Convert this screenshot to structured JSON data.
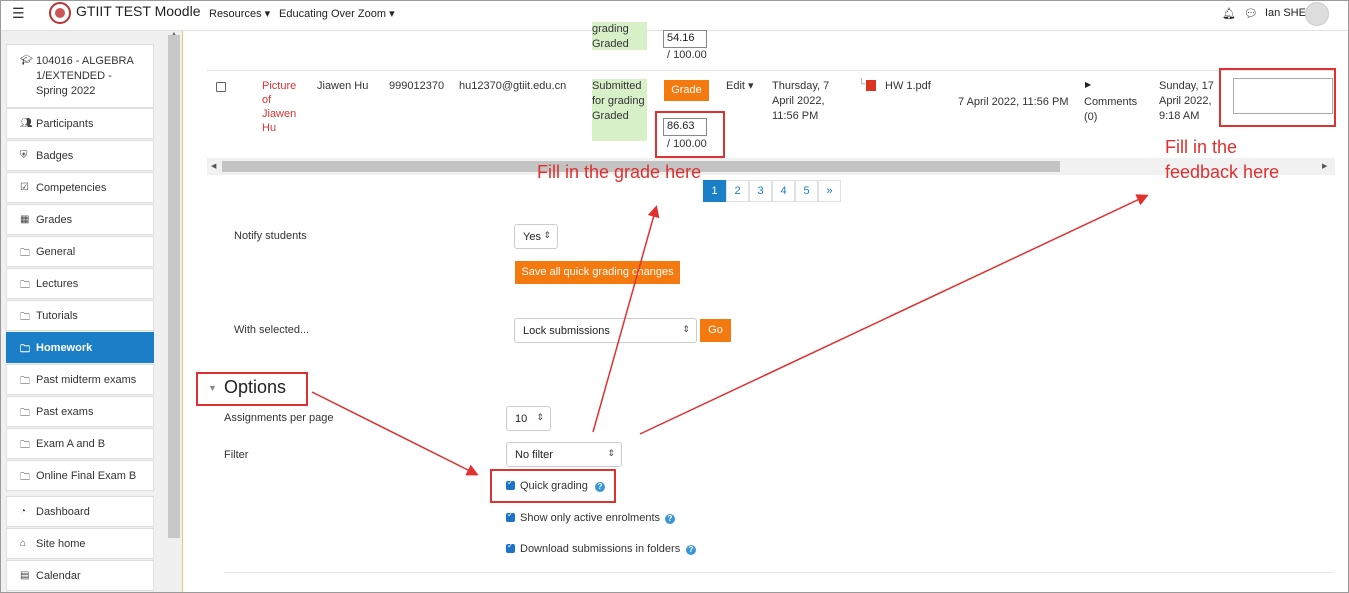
{
  "navbar": {
    "site_name": "GTIIT TEST Moodle",
    "menu_resources": "Resources",
    "menu_zoom": "Educating Over Zoom",
    "user_name": "Ian SHE"
  },
  "sidebar": {
    "course": "104016 - ALGEBRA 1/EXTENDED - Spring 2022",
    "items": [
      {
        "label": "Participants",
        "icon": "users-icon"
      },
      {
        "label": "Badges",
        "icon": "shield-icon"
      },
      {
        "label": "Competencies",
        "icon": "check-square-icon"
      },
      {
        "label": "Grades",
        "icon": "table-icon"
      },
      {
        "label": "General",
        "icon": "folder-icon"
      },
      {
        "label": "Lectures",
        "icon": "folder-icon"
      },
      {
        "label": "Tutorials",
        "icon": "folder-icon"
      },
      {
        "label": "Homework",
        "icon": "folder-icon"
      },
      {
        "label": "Past midterm exams",
        "icon": "folder-icon"
      },
      {
        "label": "Past exams",
        "icon": "folder-icon"
      },
      {
        "label": "Exam A and B",
        "icon": "folder-icon"
      },
      {
        "label": "Online Final Exam B",
        "icon": "folder-icon"
      }
    ],
    "bottom_items": [
      {
        "label": "Dashboard",
        "icon": "dashboard-icon"
      },
      {
        "label": "Site home",
        "icon": "home-icon"
      },
      {
        "label": "Calendar",
        "icon": "calendar-icon"
      }
    ]
  },
  "prev_row": {
    "status_1": "grading",
    "status_2": "Graded",
    "grade_value": "54.16",
    "grade_max": "/ 100.00"
  },
  "row": {
    "picture_alt": "Picture of Jiawen Hu",
    "name": "Jiawen Hu",
    "id_number": "999012370",
    "email": "hu12370@gtiit.edu.cn",
    "status": "Submitted for grading Graded",
    "grade_button": "Grade",
    "grade_value": "86.63",
    "grade_max": "/ 100.00",
    "edit_label": "Edit",
    "last_modified": "Thursday, 7 April 2022, 11:56 PM",
    "file_name": "HW 1.pdf",
    "file_date": "7 April 2022, 11:56 PM",
    "comments": "Comments (0)",
    "final_grade_date": "Sunday, 17 April 2022, 9:18 AM"
  },
  "pagination": [
    "1",
    "2",
    "3",
    "4",
    "5",
    "»"
  ],
  "form": {
    "notify_label": "Notify students",
    "notify_value": "Yes",
    "save_button": "Save all quick grading changes",
    "with_selected_label": "With selected...",
    "with_selected_value": "Lock submissions",
    "go_button": "Go"
  },
  "options": {
    "heading": "Options",
    "per_page_label": "Assignments per page",
    "per_page_value": "10",
    "filter_label": "Filter",
    "filter_value": "No filter",
    "quick_grading": "Quick grading",
    "show_active": "Show only active enrolments",
    "download_folders": "Download submissions in folders"
  },
  "annotations": {
    "grade_note": "Fill in the grade here",
    "feedback_note": "Fill in the feedback here"
  },
  "colors": {
    "accent": "#1a7fc6",
    "button": "#f47a10",
    "annotation": "#e03030",
    "status_green": "#d8f0c8"
  }
}
